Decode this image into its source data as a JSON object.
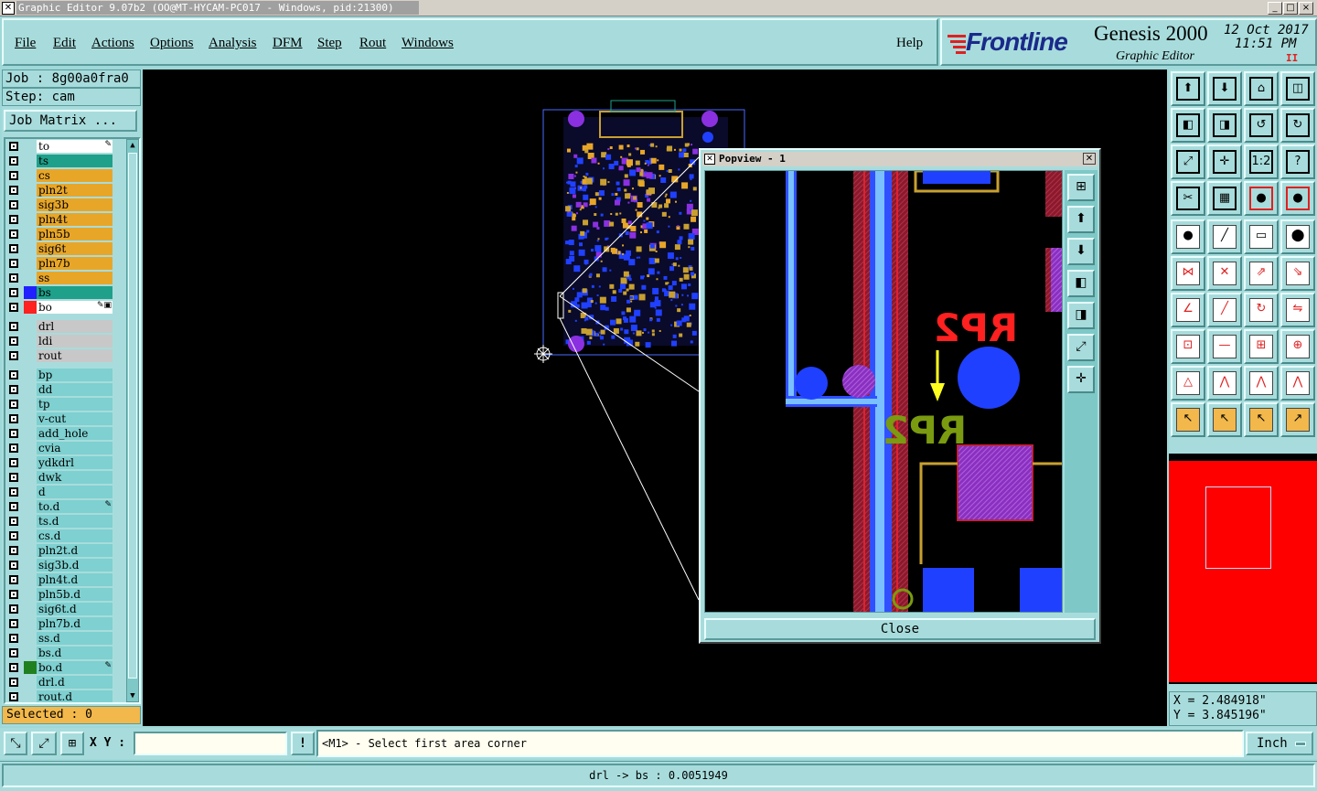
{
  "window": {
    "title": "Graphic Editor 9.07b2 (OO@MT-HYCAM-PC017 - Windows, pid:21300)",
    "min_label": "_",
    "max_label": "□",
    "close_label": "×"
  },
  "menu": {
    "items": [
      "File",
      "Edit",
      "Actions",
      "Options",
      "Analysis",
      "DFM",
      "Step",
      "Rout",
      "Windows"
    ],
    "help": "Help"
  },
  "brand": {
    "logo": "Frontline",
    "product": "Genesis 2000",
    "subtitle": "Graphic Editor",
    "date": "12 Oct 2017",
    "time": "11:51 PM",
    "indicator": "II"
  },
  "job": {
    "job_label": "Job : 8g00a0fra0",
    "step_label": "Step: cam",
    "matrix_button": "Job Matrix ..."
  },
  "layers": {
    "group1": [
      {
        "name": "to",
        "color": "#ffffff",
        "mark": "✎",
        "swatch": ""
      },
      {
        "name": "ts",
        "color": "#1fa08a",
        "mark": "",
        "swatch": ""
      },
      {
        "name": "cs",
        "color": "#e8a628",
        "mark": "",
        "swatch": ""
      },
      {
        "name": "pln2t",
        "color": "#e8a628",
        "mark": "",
        "swatch": ""
      },
      {
        "name": "sig3b",
        "color": "#e8a628",
        "mark": "",
        "swatch": ""
      },
      {
        "name": "pln4t",
        "color": "#e8a628",
        "mark": "",
        "swatch": ""
      },
      {
        "name": "pln5b",
        "color": "#e8a628",
        "mark": "",
        "swatch": ""
      },
      {
        "name": "sig6t",
        "color": "#e8a628",
        "mark": "",
        "swatch": ""
      },
      {
        "name": "pln7b",
        "color": "#e8a628",
        "mark": "",
        "swatch": ""
      },
      {
        "name": "ss",
        "color": "#e8a628",
        "mark": "",
        "swatch": ""
      },
      {
        "name": "bs",
        "color": "#1fa08a",
        "mark": "",
        "swatch": "#2020ff"
      },
      {
        "name": "bo",
        "color": "#ffffff",
        "mark": "✎▣",
        "swatch": "#ff2020"
      }
    ],
    "group2": [
      {
        "name": "drl",
        "color": "#c8c8c8"
      },
      {
        "name": "ldi",
        "color": "#c8c8c8"
      },
      {
        "name": "rout",
        "color": "#c8c8c8"
      }
    ],
    "group3": [
      {
        "name": "bp",
        "mark": ""
      },
      {
        "name": "dd",
        "mark": ""
      },
      {
        "name": "tp",
        "mark": ""
      },
      {
        "name": "v-cut",
        "mark": ""
      },
      {
        "name": "add_hole",
        "mark": ""
      },
      {
        "name": "cvia",
        "mark": ""
      },
      {
        "name": "ydkdrl",
        "mark": ""
      },
      {
        "name": "dwk",
        "mark": ""
      },
      {
        "name": "d",
        "mark": ""
      },
      {
        "name": "to.d",
        "mark": "✎"
      },
      {
        "name": "ts.d",
        "mark": ""
      },
      {
        "name": "cs.d",
        "mark": ""
      },
      {
        "name": "pln2t.d",
        "mark": ""
      },
      {
        "name": "sig3b.d",
        "mark": ""
      },
      {
        "name": "pln4t.d",
        "mark": ""
      },
      {
        "name": "pln5b.d",
        "mark": ""
      },
      {
        "name": "sig6t.d",
        "mark": ""
      },
      {
        "name": "pln7b.d",
        "mark": ""
      },
      {
        "name": "ss.d",
        "mark": ""
      },
      {
        "name": "bs.d",
        "mark": ""
      },
      {
        "name": "bo.d",
        "mark": "✎"
      },
      {
        "name": "drl.d",
        "mark": ""
      },
      {
        "name": "rout.d",
        "mark": ""
      }
    ],
    "list_color": "#7fd0d0"
  },
  "selected_label": "Selected : 0",
  "popview": {
    "title": "Popview - 1",
    "close_button": "Close",
    "ref_top": "RP2",
    "ref_bottom": "RP2"
  },
  "coords": {
    "x": "X = 2.484918\"",
    "y": "Y = 3.845196\""
  },
  "command": {
    "xy_label": "X Y :",
    "xy_value": "",
    "prompt": "<M1> - Select first area corner",
    "unit": "Inch"
  },
  "status": {
    "text": "drl -> bs : 0.0051949"
  }
}
